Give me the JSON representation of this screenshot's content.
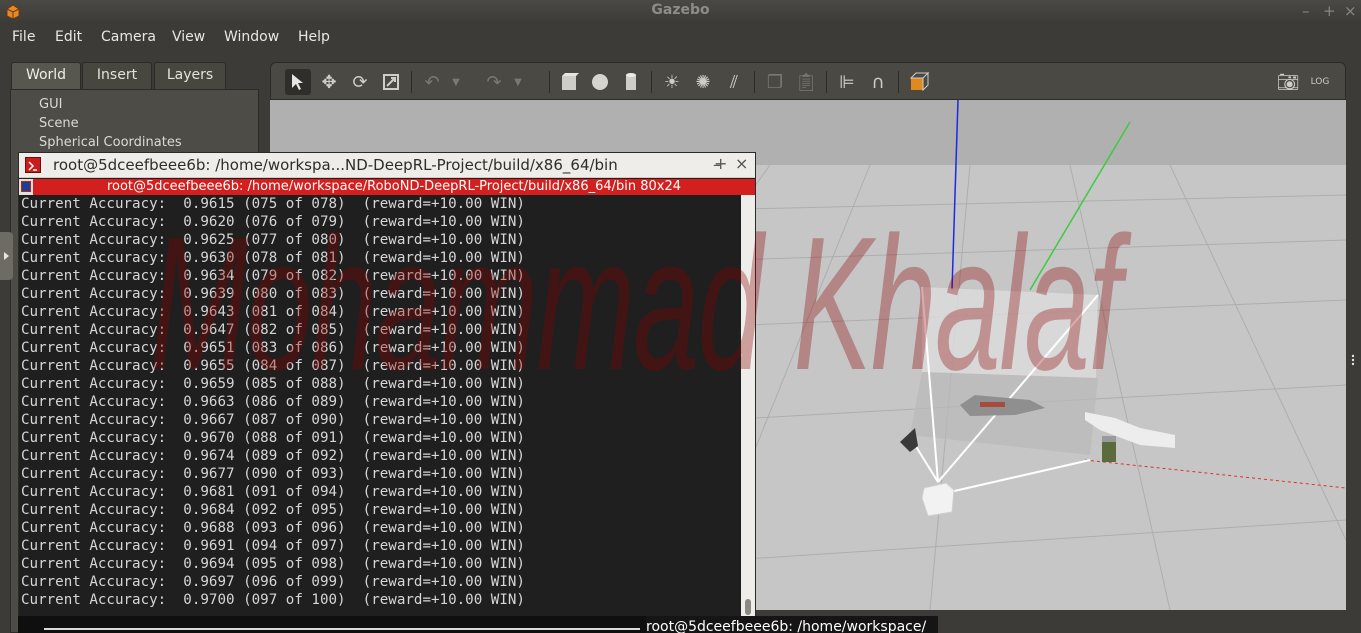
{
  "window": {
    "title": "Gazebo",
    "controls": [
      "–",
      "+",
      "×"
    ]
  },
  "menu": [
    "File",
    "Edit",
    "Camera",
    "View",
    "Window",
    "Help"
  ],
  "left_panel": {
    "tabs": [
      "World",
      "Insert",
      "Layers"
    ],
    "active_tab": "World",
    "tree_items": [
      "GUI",
      "Scene",
      "Spherical Coordinates"
    ]
  },
  "toolbar": {
    "tools": [
      "select-arrow",
      "translate",
      "rotate",
      "scale",
      "undo",
      "redo",
      "box",
      "sphere",
      "cylinder",
      "point-light",
      "spot-light",
      "directional-light",
      "copy",
      "paste",
      "align",
      "snap",
      "change-view",
      "screenshot",
      "log"
    ]
  },
  "terminal": {
    "title": "root@5dceefbeee6b: /home/workspa...ND-DeepRL-Project/build/x86_64/bin",
    "tab_label": "root@5dceefbeee6b: /home/workspace/RoboND-DeepRL-Project/build/x86_64/bin 80x24",
    "lines": [
      "Current Accuracy:  0.9615 (075 of 078)  (reward=+10.00 WIN)",
      "Current Accuracy:  0.9620 (076 of 079)  (reward=+10.00 WIN)",
      "Current Accuracy:  0.9625 (077 of 080)  (reward=+10.00 WIN)",
      "Current Accuracy:  0.9630 (078 of 081)  (reward=+10.00 WIN)",
      "Current Accuracy:  0.9634 (079 of 082)  (reward=+10.00 WIN)",
      "Current Accuracy:  0.9639 (080 of 083)  (reward=+10.00 WIN)",
      "Current Accuracy:  0.9643 (081 of 084)  (reward=+10.00 WIN)",
      "Current Accuracy:  0.9647 (082 of 085)  (reward=+10.00 WIN)",
      "Current Accuracy:  0.9651 (083 of 086)  (reward=+10.00 WIN)",
      "Current Accuracy:  0.9655 (084 of 087)  (reward=+10.00 WIN)",
      "Current Accuracy:  0.9659 (085 of 088)  (reward=+10.00 WIN)",
      "Current Accuracy:  0.9663 (086 of 089)  (reward=+10.00 WIN)",
      "Current Accuracy:  0.9667 (087 of 090)  (reward=+10.00 WIN)",
      "Current Accuracy:  0.9670 (088 of 091)  (reward=+10.00 WIN)",
      "Current Accuracy:  0.9674 (089 of 092)  (reward=+10.00 WIN)",
      "Current Accuracy:  0.9677 (090 of 093)  (reward=+10.00 WIN)",
      "Current Accuracy:  0.9681 (091 of 094)  (reward=+10.00 WIN)",
      "Current Accuracy:  0.9684 (092 of 095)  (reward=+10.00 WIN)",
      "Current Accuracy:  0.9688 (093 of 096)  (reward=+10.00 WIN)",
      "Current Accuracy:  0.9691 (094 of 097)  (reward=+10.00 WIN)",
      "Current Accuracy:  0.9694 (095 of 098)  (reward=+10.00 WIN)",
      "Current Accuracy:  0.9697 (096 of 099)  (reward=+10.00 WIN)",
      "Current Accuracy:  0.9700 (097 of 100)  (reward=+10.00 WIN)"
    ]
  },
  "taskbar": {
    "label": "root@5dceefbeee6b: /home/workspace/"
  },
  "watermark": "Mohammad Khalaf",
  "colors": {
    "terminal_tab": "#d41f1f",
    "axis_x": "#e03030",
    "axis_y": "#3ccc3c",
    "axis_z": "#1a2be0",
    "ui_dark": "#3c3b37"
  }
}
